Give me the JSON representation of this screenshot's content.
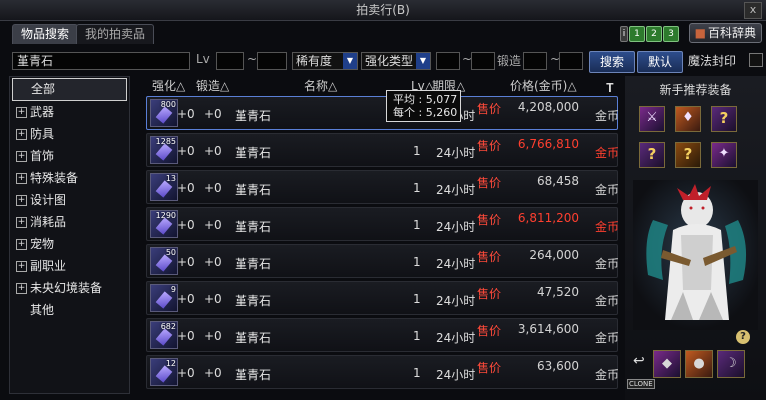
{
  "window": {
    "title": "拍卖行(B)",
    "close": "x"
  },
  "tabs": [
    "物品搜索",
    "我的拍卖品"
  ],
  "pages": [
    "i",
    "1",
    "2",
    "3"
  ],
  "encyclopedia": "百科辞典",
  "search": {
    "item_name": "堇青石",
    "lv_label": "Lv",
    "tilde": "~",
    "rarity": "稀有度",
    "enhance_type": "强化类型",
    "forge_label": "锻造",
    "search_btn": "搜索",
    "default_btn": "默认",
    "seal_label": "魔法封印"
  },
  "categories": {
    "all": "全部",
    "items": [
      "武器",
      "防具",
      "首饰",
      "特殊装备",
      "设计图",
      "消耗品",
      "宠物",
      "副职业",
      "未央幻境装备"
    ],
    "other": "其他"
  },
  "table": {
    "headers": {
      "enhance": "强化△",
      "forge": "锻造△",
      "name": "名称△",
      "lv": "Lv△",
      "period": "期限△",
      "price": "价格(金币)△"
    },
    "rows": [
      {
        "qty": "800",
        "enhance": "+0",
        "forge": "+0",
        "name": "堇青石",
        "count": "1",
        "time": "24小时",
        "type": "售价",
        "price": "4,208,000",
        "price_color": "normal",
        "unit": "金币"
      },
      {
        "qty": "1285",
        "enhance": "+0",
        "forge": "+0",
        "name": "堇青石",
        "count": "1",
        "time": "24小时",
        "type": "售价",
        "price": "6,766,810",
        "price_color": "red",
        "unit": "金币"
      },
      {
        "qty": "13",
        "enhance": "+0",
        "forge": "+0",
        "name": "堇青石",
        "count": "1",
        "time": "24小时",
        "type": "售价",
        "price": "68,458",
        "price_color": "normal",
        "unit": "金币"
      },
      {
        "qty": "1290",
        "enhance": "+0",
        "forge": "+0",
        "name": "堇青石",
        "count": "1",
        "time": "24小时",
        "type": "售价",
        "price": "6,811,200",
        "price_color": "red",
        "unit": "金币"
      },
      {
        "qty": "50",
        "enhance": "+0",
        "forge": "+0",
        "name": "堇青石",
        "count": "1",
        "time": "24小时",
        "type": "售价",
        "price": "264,000",
        "price_color": "normal",
        "unit": "金币"
      },
      {
        "qty": "9",
        "enhance": "+0",
        "forge": "+0",
        "name": "堇青石",
        "count": "1",
        "time": "24小时",
        "type": "售价",
        "price": "47,520",
        "price_color": "normal",
        "unit": "金币"
      },
      {
        "qty": "682",
        "enhance": "+0",
        "forge": "+0",
        "name": "堇青石",
        "count": "1",
        "time": "24小时",
        "type": "售价",
        "price": "3,614,600",
        "price_color": "normal",
        "unit": "金币"
      },
      {
        "qty": "12",
        "enhance": "+0",
        "forge": "+0",
        "name": "堇青石",
        "count": "1",
        "time": "24小时",
        "type": "售价",
        "price": "63,600",
        "price_color": "normal",
        "unit": "金币"
      }
    ]
  },
  "tooltip": {
    "avg_label": "平均",
    "avg_value": "5,077",
    "each_label": "每个",
    "each_value": "5,260"
  },
  "recommend": {
    "title": "新手推荐装备",
    "help": "?",
    "clone_label": "CLONE"
  },
  "colors": {
    "price_red": "#ff3f2f",
    "sale_red": "#ff4a3a",
    "accent_blue": "#5a7fd6"
  }
}
